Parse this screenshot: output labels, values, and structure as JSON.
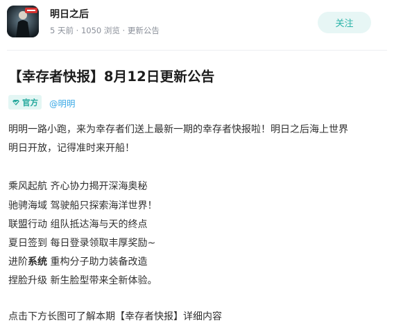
{
  "author": {
    "name": "明日之后",
    "meta": "5 天前 · 1050 浏览 · 更新公告",
    "avatar_icon": "game-avatar-icon"
  },
  "follow_label": "关注",
  "post": {
    "title": "【幸存者快报】8月12日更新公告",
    "badge_label": "官方",
    "mention": "@明明",
    "intro_line1": "明明一路小跑，来为幸存者们送上最新一期的幸存者快报啦！明日之后海上世界",
    "intro_line2": "明日开放，记得准时来开船！",
    "features": [
      "乘风起航 齐心协力揭开深海奥秘",
      "驰骋海域 驾驶船只探索海洋世界！",
      "联盟行动 组队抵达海与天的终点",
      "夏日签到 每日登录领取丰厚奖励~",
      "重构分子助力装备改造",
      "捏脸升级 新生脸型带来全新体验。"
    ],
    "feature5_prefix": "进阶",
    "feature5_bold": "系统",
    "cut_line": "点击下方长图可了解本期【幸存者快报】详细内容"
  },
  "colors": {
    "accent": "#2bb3a8",
    "mention": "#3aa9e6"
  }
}
